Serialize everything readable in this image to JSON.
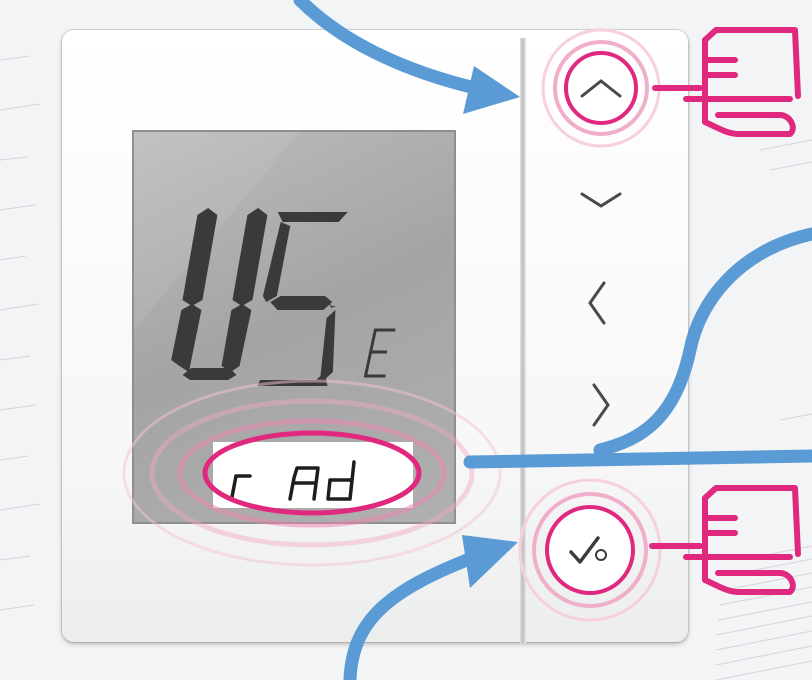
{
  "display": {
    "main_text": "USE",
    "main_suffix": "E",
    "sub_text": "r Ad"
  },
  "buttons": [
    {
      "id": "up",
      "icon": "chevron-up-icon"
    },
    {
      "id": "down",
      "icon": "chevron-down-icon"
    },
    {
      "id": "left",
      "icon": "chevron-left-icon"
    },
    {
      "id": "right",
      "icon": "chevron-right-icon"
    },
    {
      "id": "confirm",
      "icon": "check-gear-icon"
    }
  ],
  "colors": {
    "arrow_blue": "#5b9bd5",
    "highlight_pink": "#e0287f",
    "lcd_segment": "#3b3b3b",
    "lcd_background": "#a9a9a9"
  }
}
